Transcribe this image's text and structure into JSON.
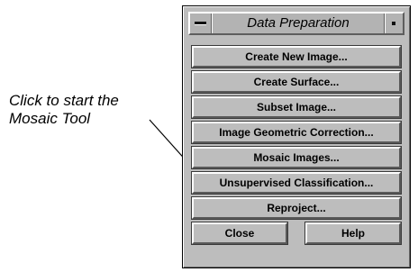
{
  "annotation": {
    "line1": "Click to start the",
    "line2": "Mosaic Tool"
  },
  "window": {
    "title": "Data Preparation",
    "menu_icon": "window-menu-icon",
    "minimize_icon": "minimize-icon"
  },
  "buttons": [
    {
      "label": "Create New Image..."
    },
    {
      "label": "Create Surface..."
    },
    {
      "label": "Subset Image..."
    },
    {
      "label": "Image Geometric Correction..."
    },
    {
      "label": "Mosaic Images..."
    },
    {
      "label": "Unsupervised Classification..."
    },
    {
      "label": "Reproject..."
    }
  ],
  "footer": {
    "close_label": "Close",
    "help_label": "Help"
  }
}
